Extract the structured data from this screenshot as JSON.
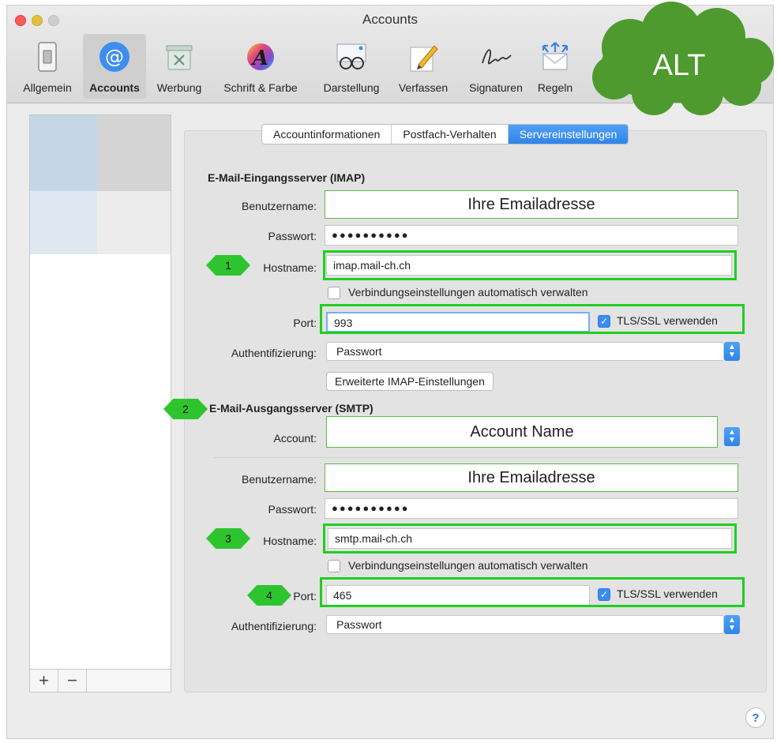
{
  "window": {
    "title": "Accounts"
  },
  "toolbar": {
    "items": [
      {
        "label": "Allgemein",
        "icon": "switch-icon"
      },
      {
        "label": "Accounts",
        "icon": "at-icon"
      },
      {
        "label": "Werbung",
        "icon": "junk-bin-icon"
      },
      {
        "label": "Schrift & Farbe",
        "icon": "font-color-icon"
      },
      {
        "label": "Darstellung",
        "icon": "glasses-icon"
      },
      {
        "label": "Verfassen",
        "icon": "pencil-icon"
      },
      {
        "label": "Signaturen",
        "icon": "signature-icon"
      },
      {
        "label": "Regeln",
        "icon": "rules-envelope-icon"
      }
    ]
  },
  "overlay": {
    "cloud_label": "ALT",
    "cloud_color": "#4e9a2e"
  },
  "tabs": [
    "Accountinformationen",
    "Postfach-Verhalten",
    "Servereinstellungen"
  ],
  "incoming": {
    "title": "E-Mail-Eingangsserver (IMAP)",
    "username_label": "Benutzername:",
    "username_value": "Ihre Emailadresse",
    "password_label": "Passwort:",
    "password_value": "●●●●●●●●●●",
    "hostname_label": "Hostname:",
    "hostname_value": "imap.mail-ch.ch",
    "auto_manage_label": "Verbindungseinstellungen automatisch verwalten",
    "port_label": "Port:",
    "port_value": "993",
    "tls_label": "TLS/SSL verwenden",
    "auth_label": "Authentifizierung:",
    "auth_value": "Passwort",
    "advanced_button": "Erweiterte IMAP-Einstellungen"
  },
  "outgoing": {
    "title": "E-Mail-Ausgangsserver (SMTP)",
    "account_label": "Account:",
    "account_value": "Account Name",
    "username_label": "Benutzername:",
    "username_value": "Ihre Emailadresse",
    "password_label": "Passwort:",
    "password_value": "●●●●●●●●●●",
    "hostname_label": "Hostname:",
    "hostname_value": "smtp.mail-ch.ch",
    "auto_manage_label": "Verbindungseinstellungen automatisch verwalten",
    "port_label": "Port:",
    "port_value": "465",
    "tls_label": "TLS/SSL verwenden",
    "auth_label": "Authentifizierung:",
    "auth_value": "Passwort"
  },
  "badges": [
    "1",
    "2",
    "3",
    "4"
  ],
  "sidebar": {
    "add": "+",
    "remove": "−"
  },
  "help": "?",
  "colors": {
    "accent": "#2f84ea",
    "highlight": "#1fcf1f",
    "badge": "#2ec42e"
  }
}
